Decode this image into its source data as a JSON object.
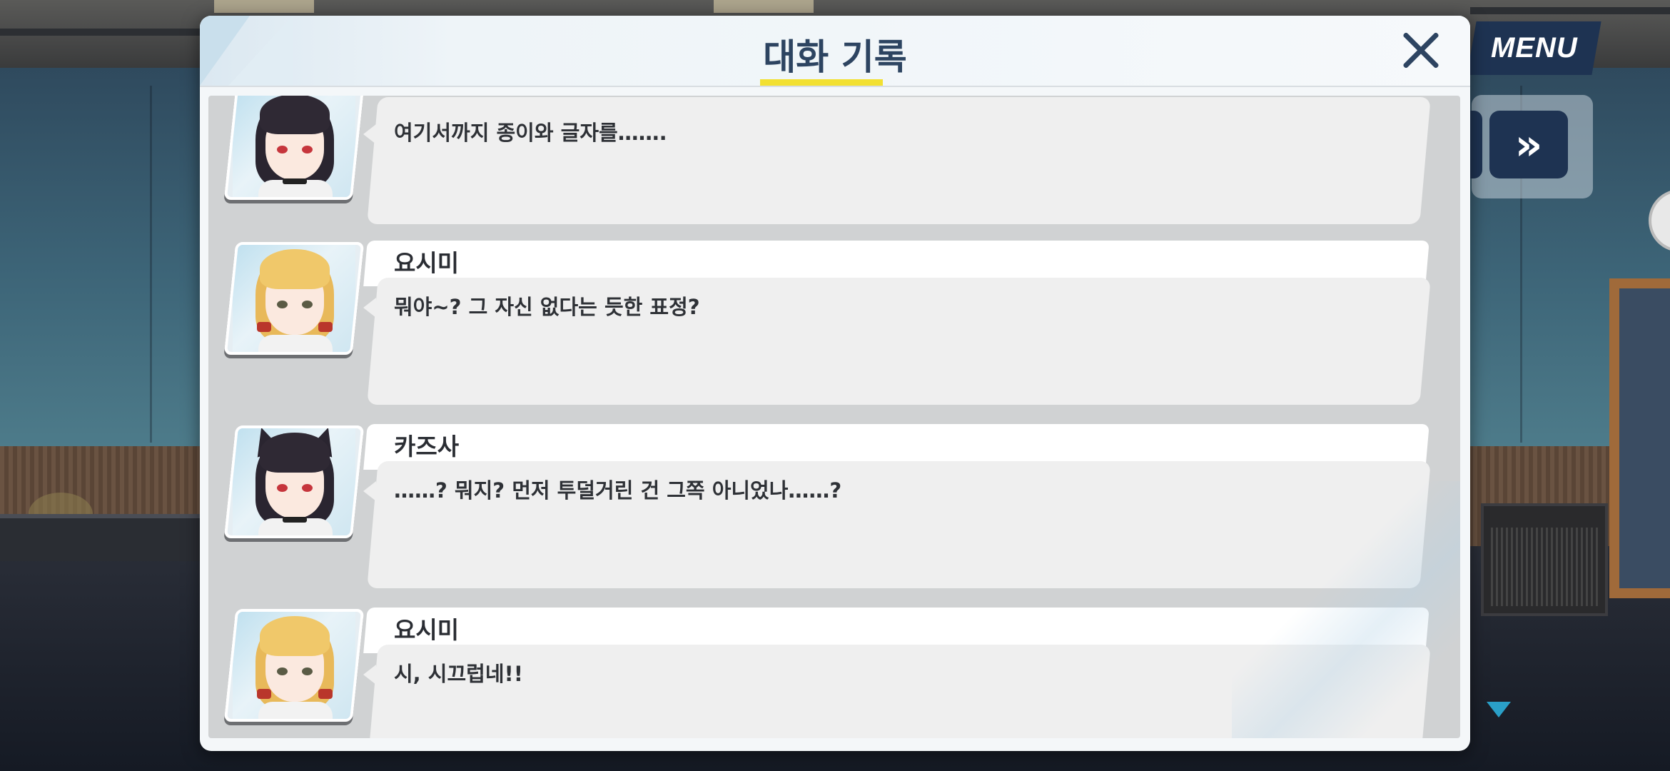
{
  "hud": {
    "menu_label": "MENU",
    "fast_forward_glyph": "»"
  },
  "dialog": {
    "title": "대화 기록",
    "close_glyph": "×"
  },
  "log": [
    {
      "speaker": "",
      "portrait": "kazusa-icon",
      "text": "여기서까지 종이와 글자를……."
    },
    {
      "speaker": "요시미",
      "portrait": "yoshimi-icon",
      "text": "뭐야~? 그 자신 없다는 듯한 표정?"
    },
    {
      "speaker": "카즈사",
      "portrait": "kazusa-icon",
      "text": "……? 뭐지? 먼저 투덜거린 건 그쪽 아니었나……?"
    },
    {
      "speaker": "요시미",
      "portrait": "yoshimi-icon",
      "text": "시, 시끄럽네!!"
    }
  ],
  "colors": {
    "accent_navy": "#2d4461",
    "title_underline": "#f2e032",
    "hud_button": "#1e3352",
    "scroll_indicator": "#2aa0c8"
  }
}
